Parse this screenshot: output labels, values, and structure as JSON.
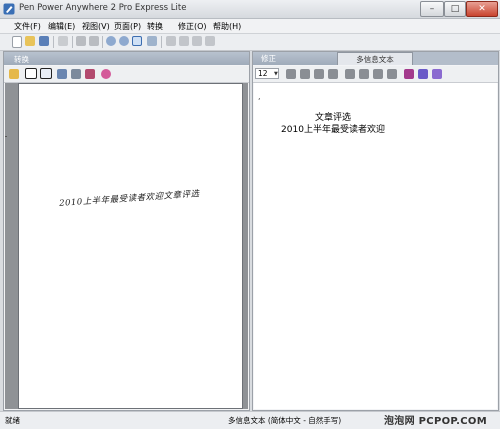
{
  "window": {
    "title": "Pen Power Anywhere 2 Pro Express Lite"
  },
  "menu": [
    "文件(F)",
    "编辑(E)",
    "视图(V)",
    "页面(P)",
    "转换",
    "修正(O)",
    "帮助(H)"
  ],
  "left_panel": {
    "header": "转换"
  },
  "right_panel": {
    "tabs": [
      "修正",
      "多信息文本"
    ],
    "font_size": "12",
    "text_lines": [
      "文章评选",
      "2010上半年最受读者欢迎"
    ]
  },
  "document": {
    "handwriting": "2010上半年最受读者欢迎文章评选"
  },
  "status": {
    "left": "就绪",
    "mode": "多信息文本 (简体中文 - 自然手写)"
  },
  "watermark": "泡泡网 PCPOP.COM",
  "colors": {
    "accent": "#9fabba",
    "close": "#c9442f"
  }
}
